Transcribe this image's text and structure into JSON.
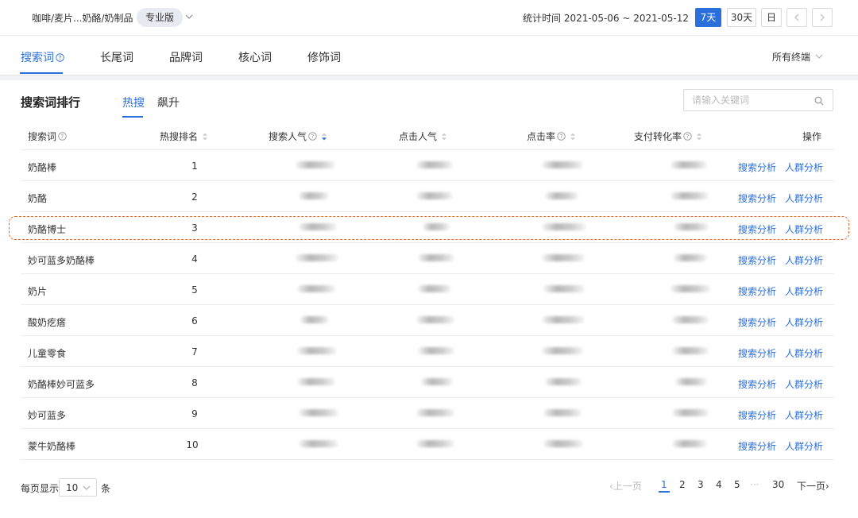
{
  "header": {
    "breadcrumb": "咖啡/麦片...奶酪/奶制品",
    "edition": "专业版",
    "stat_time_label": "统计时间 2021-05-06 ~ 2021-05-12",
    "period_buttons": [
      "7天",
      "30天",
      "日"
    ],
    "active_period": "7天"
  },
  "tabs": {
    "items": [
      "搜索词",
      "长尾词",
      "品牌词",
      "核心词",
      "修饰词"
    ],
    "active": "搜索词",
    "terminal_label": "所有终端"
  },
  "section": {
    "title": "搜索词排行",
    "subtabs": [
      "热搜",
      "飙升"
    ],
    "active_subtab": "热搜",
    "search_placeholder": "请输入关键词"
  },
  "table": {
    "headers": [
      "搜索词",
      "热搜排名",
      "搜索人气",
      "点击人气",
      "点击率",
      "支付转化率",
      "操作"
    ],
    "sorted_by": "搜索人气",
    "sort_direction": "descending",
    "rows": [
      {
        "keyword": "奶酪棒",
        "rank": "1"
      },
      {
        "keyword": "奶酪",
        "rank": "2"
      },
      {
        "keyword": "奶酪博士",
        "rank": "3"
      },
      {
        "keyword": "妙可蓝多奶酪棒",
        "rank": "4"
      },
      {
        "keyword": "奶片",
        "rank": "5"
      },
      {
        "keyword": "酸奶疙瘩",
        "rank": "6"
      },
      {
        "keyword": "儿童零食",
        "rank": "7"
      },
      {
        "keyword": "奶酪棒妙可蓝多",
        "rank": "8"
      },
      {
        "keyword": "妙可蓝多",
        "rank": "9"
      },
      {
        "keyword": "蒙牛奶酪棒",
        "rank": "10"
      }
    ],
    "actions": [
      "搜索分析",
      "人群分析"
    ],
    "highlighted_keyword": "奶酪博士",
    "highlight_color": "#e8692a"
  },
  "pagination": {
    "page_size_label": "每页显示",
    "page_size": "10",
    "page_size_unit": "条",
    "prev_label": "上一页",
    "next_label": "下一页",
    "pages": [
      "1",
      "2",
      "3",
      "4",
      "5"
    ],
    "ellipsis": "···",
    "last_page": "30",
    "current_page": "1"
  },
  "colors": {
    "accent": "#2a6fdb",
    "highlight_border": "#e8692a"
  }
}
